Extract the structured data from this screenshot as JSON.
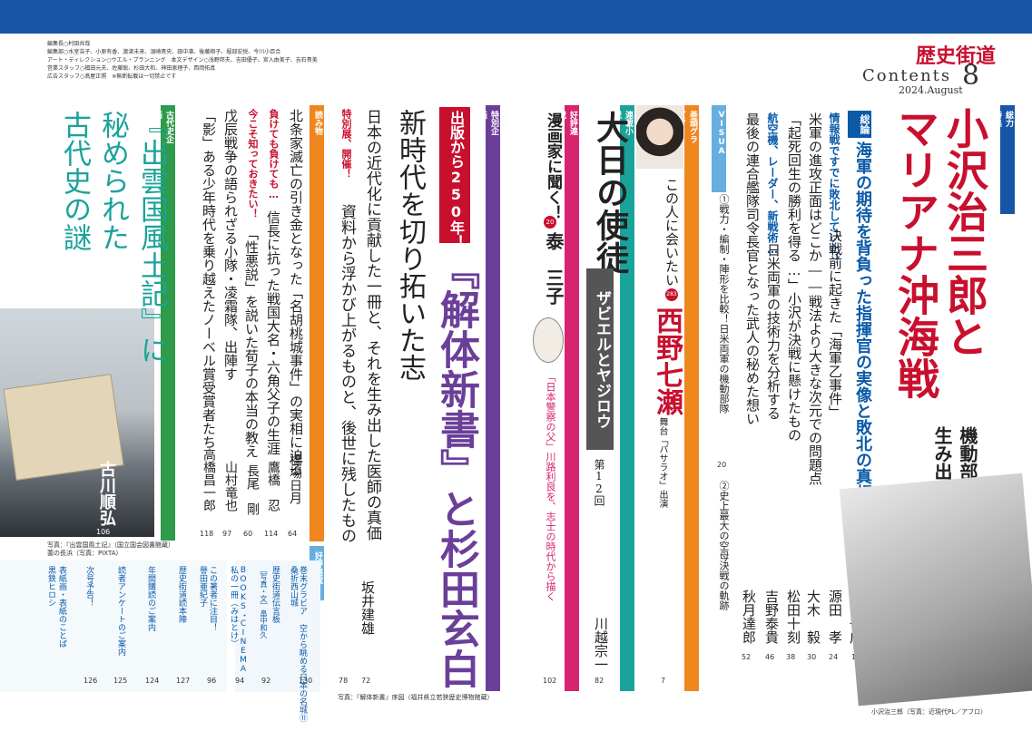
{
  "header": {
    "logo": "歴史街道",
    "contents_label": "Contents",
    "issue_number": "8",
    "date": "2024.August",
    "credits": [
      "編集長○村田共哉",
      "編集部○水室浩子、小原有香、渡津未来、須崎貴央、田中凛、後藤翔子、堀部宏悦、今川小百合",
      "アート・ディレクション○ウエル・プランニング　本文デザイン○浅野邦夫、吉田優子、宮入由美子、吉石貴美",
      "営業スタッフ○楢田元夫、佐藤聡、杉田大和、神田恵理子、西岡拓真",
      "広告スタッフ○髙屋正照　※無断転載は一切禁止です"
    ]
  },
  "sections": {
    "soryoku_tab": "総力特集",
    "kantou_tab": "巻頭グラビア",
    "rensai_tab": "連載小説",
    "kouhyou_tab": "好評連載",
    "tokubetsu_tab": "特別企画",
    "yomimono_tab": "読み物",
    "kodaishi_tab": "古代史企画",
    "kouhyou2_tab": "好評連載",
    "visual_tab": "VISUAL"
  },
  "feature": {
    "title1": "小沢治三郎と",
    "title2": "マリアナ沖海戦",
    "sub1": "機動部隊を",
    "sub2": "生み出した男の決断",
    "soron_badge": "総論",
    "soron_text": "海軍の期待を背負った指揮官の実像と敗北の真相",
    "article1_lead": "情報戦ですでに敗北していた！",
    "article1_title": "決戦前に起きた「海軍乙事件」",
    "article1_author": "戸高一成",
    "article1_page": "14",
    "article2_title": "米軍の進攻正面はどこか――戦法より大きな次元での問題点",
    "article2_author": "源田　孝",
    "article2_page": "24",
    "article3_title": "「起死回生の勝利を得る…」小沢が決戦に懸けたもの",
    "article3_author": "大木　毅",
    "article3_page": "30",
    "article4_lead": "航空機、レーダー、新戦術…",
    "article4_title": "日米両軍の技術力を分析する",
    "article4_author": "松田十刻",
    "article4_page": "38",
    "article5_title": "最後の連合艦隊司令長官となった武人の秘めた想い",
    "article5_author": "吉野泰貴",
    "article5_page": "46",
    "visual1": "①戦力・編制・陣形を比較！日米両軍の機動部隊",
    "visual1_page": "20",
    "visual2": "②史上最大の空母決戦の軌跡",
    "visual2_author": "秋月達郎",
    "visual2_page": "52",
    "photo_caption": "小沢治三郎（写真：近現代PL／アフロ）"
  },
  "gravure": {
    "lead": "この人に会いたい",
    "number": "283",
    "name": "西野七瀬",
    "note": "舞台「パサラオ」出演",
    "page": "7"
  },
  "novel": {
    "title": "大日の使徒",
    "subtitle": "ザビエルとヤジロウ",
    "episode": "第12回",
    "author": "川越宗一",
    "page": "82"
  },
  "manga": {
    "lead": "漫画家に聞く！",
    "number": "20",
    "name": "泰　三子",
    "desc": "「日本警察の父」川路利良を、志士の時代から描く",
    "page": "102"
  },
  "special": {
    "badge": "出版から250年！",
    "title": "『解体新書』と杉田玄白",
    "catch": "新時代を切り拓いた志",
    "desc": "日本の近代化に貢献した一冊と、それを生み出した医師の真価",
    "author1": "坂井建雄",
    "page1": "72",
    "sub_lead": "特別展、開催！",
    "sub_text": "資料から浮かび上がるものと、後世に残したもの",
    "page2": "78",
    "caption": "写真：『解体新書』序図（福井県立若狭歴史博物館蔵）"
  },
  "yomimono": [
    {
      "lead": "",
      "title": "北条家滅亡の引き金となった「名胡桃城事件」の実相に迫る",
      "author": "橋場日月",
      "page": "64"
    },
    {
      "lead": "負けても負けても…",
      "title": "信長に抗った戦国大名・六角父子の生涯",
      "author": "鷹橋　忍",
      "page": "114"
    },
    {
      "lead": "今こそ知っておきたい！",
      "title": "「性悪説」を説いた荀子の本当の教え",
      "author": "長尾　剛",
      "page": "60"
    },
    {
      "lead": "",
      "title": "戊辰戦争の語られざる小隊・凌霜隊、出陣す",
      "author": "山村竜也",
      "page": "97"
    },
    {
      "lead": "",
      "title": "「影」ある少年時代を乗り越えたノーベル賞受賞者たち",
      "author": "高橋昌一郎",
      "page": "118"
    }
  ],
  "kodaishi": {
    "title1": "『出雲国風土記』に",
    "title2": "秘められた",
    "title3": "古代史の謎",
    "author": "古川順弘",
    "page": "106",
    "caption1": "写真：『出雲国風土記』（国立国会図書館蔵）",
    "caption2": "薗の長浜（写真：PIXTA）"
  },
  "serials": [
    {
      "title": "巻末グラビア 空から眺める日本の名城⑪",
      "sub": "桑折西山城",
      "page": "130"
    },
    {
      "title": "歴史街道伝言板",
      "sub": "［写真・文］畠中和久",
      "page": "92"
    },
    {
      "title": "BOOKS・CINEMA",
      "sub": "私の一冊（みはとけ）",
      "page": "94"
    },
    {
      "title": "この著者に注目！",
      "sub": "譽田亜紀子",
      "page": "96"
    },
    {
      "title": "歴史街道読本陣",
      "sub": "",
      "page": "127"
    },
    {
      "title": "年間購読のご案内",
      "sub": "",
      "page": "124"
    },
    {
      "title": "読者アンケートのご案内",
      "sub": "",
      "page": "125"
    },
    {
      "title": "次号予告！",
      "sub": "",
      "page": "126"
    },
    {
      "title": "表紙画・表紙のことば",
      "sub": "黒鉄ヒロシ",
      "page": ""
    }
  ],
  "colors": {
    "topband": "#1756a6",
    "red": "#c8102e",
    "blue": "#0a5aa8",
    "orange": "#f0861e",
    "purple": "#6b3f99",
    "teal": "#1aa39a",
    "magenta": "#d6246e",
    "green": "#2e9a4a",
    "sky": "#66aee0"
  }
}
